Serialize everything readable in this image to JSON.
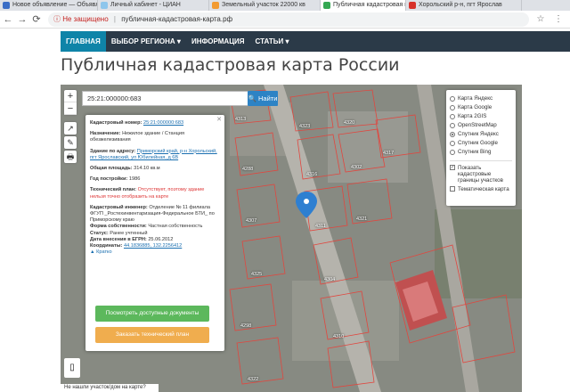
{
  "browser": {
    "tabs": [
      {
        "label": "Новое объявление — Объявл",
        "color": "#3b6ec6"
      },
      {
        "label": "Личный кабинет - ЦИАН",
        "color": "#8ec6ec"
      },
      {
        "label": "Земельный участок 22000 кв",
        "color": "#f29b32"
      },
      {
        "label": "Публичная кадастровая карта",
        "color": "#35a853",
        "active": true
      },
      {
        "label": "Хорольский р-н, пгт Ярослав",
        "color": "#d7312a"
      }
    ],
    "nav_icons": {
      "back": "←",
      "forward": "→",
      "reload": "⟳",
      "info": "ⓘ"
    },
    "security_warning": "Не защищено",
    "url": "публичная-кадастровая-карта.рф"
  },
  "site_nav": {
    "items": [
      {
        "label": "ГЛАВНАЯ",
        "active": true
      },
      {
        "label": "ВЫБОР РЕГИОНА ▾",
        "active": false
      },
      {
        "label": "ИНФОРМАЦИЯ",
        "active": false
      },
      {
        "label": "СТАТЬИ ▾",
        "active": false
      }
    ]
  },
  "page_title": "Публичная кадастровая карта России",
  "map": {
    "zoom_in": "+",
    "zoom_out": "−",
    "tools": [
      "↗",
      "✎",
      "🖶"
    ],
    "search_value": "25:21:000000:683",
    "search_button": "🔍 Найти",
    "popup": {
      "close": "✕",
      "cad_number_label": "Кадастровый номер:",
      "cad_number": "25:21:000000:683",
      "purpose_label": "Назначение:",
      "purpose": "Нежилое здание / Станция обезжелезивания",
      "address_label": "Здание по адресу:",
      "address": "Приморский край, р-н Хорольский, пгт Ярославский, ул Юбилейная, д 6В",
      "area_label": "Общая площадь:",
      "area": "314.10 кв.м",
      "year_label": "Год постройки:",
      "year": "1986",
      "tech_plan_label": "Технический план:",
      "tech_plan": "Отсутствует, поэтому здание нельзя точно отобразить на карте",
      "engineer_label": "Кадастровый инженер:",
      "engineer": "Отделение № 11 филиала ФГУП _Ростехинвентаризация-Федеральное БТИ_ по Приморскому краю",
      "ownership_label": "Форма собственности:",
      "ownership": "Частная собственность",
      "status_label": "Статус:",
      "status": "Ранее учтенный",
      "egrn_label": "Дата внесения в ЕГРН:",
      "egrn_date": "25.06.2012",
      "coords_label": "Координаты:",
      "coords": "44.1836885, 132.2256412",
      "brief": "▲ Кратко",
      "btn_docs": "Посмотреть доступные документы",
      "btn_order": "Заказать технический план"
    },
    "layers": {
      "options": [
        {
          "label": "Карта Яндекс",
          "selected": false
        },
        {
          "label": "Карта Google",
          "selected": false
        },
        {
          "label": "Карта 2GIS",
          "selected": false
        },
        {
          "label": "OpenStreetMap",
          "selected": false
        },
        {
          "label": "Спутник Яндекс",
          "selected": true
        },
        {
          "label": "Спутник Google",
          "selected": false
        },
        {
          "label": "Спутник Bing",
          "selected": false
        }
      ],
      "check_cadastral": "Показать кадастровые границы участков",
      "check_thematic": "Тематическая карта",
      "checkmark": "✓"
    },
    "bottom_text": "Не нашли участок/дом на карте?",
    "parcel_labels": [
      "4313",
      "4323",
      "4320",
      "4317",
      "4288",
      "4316",
      "4302",
      "4307",
      "4311",
      "4321",
      "4325",
      "4304",
      "4298",
      "4310",
      "4322"
    ]
  }
}
